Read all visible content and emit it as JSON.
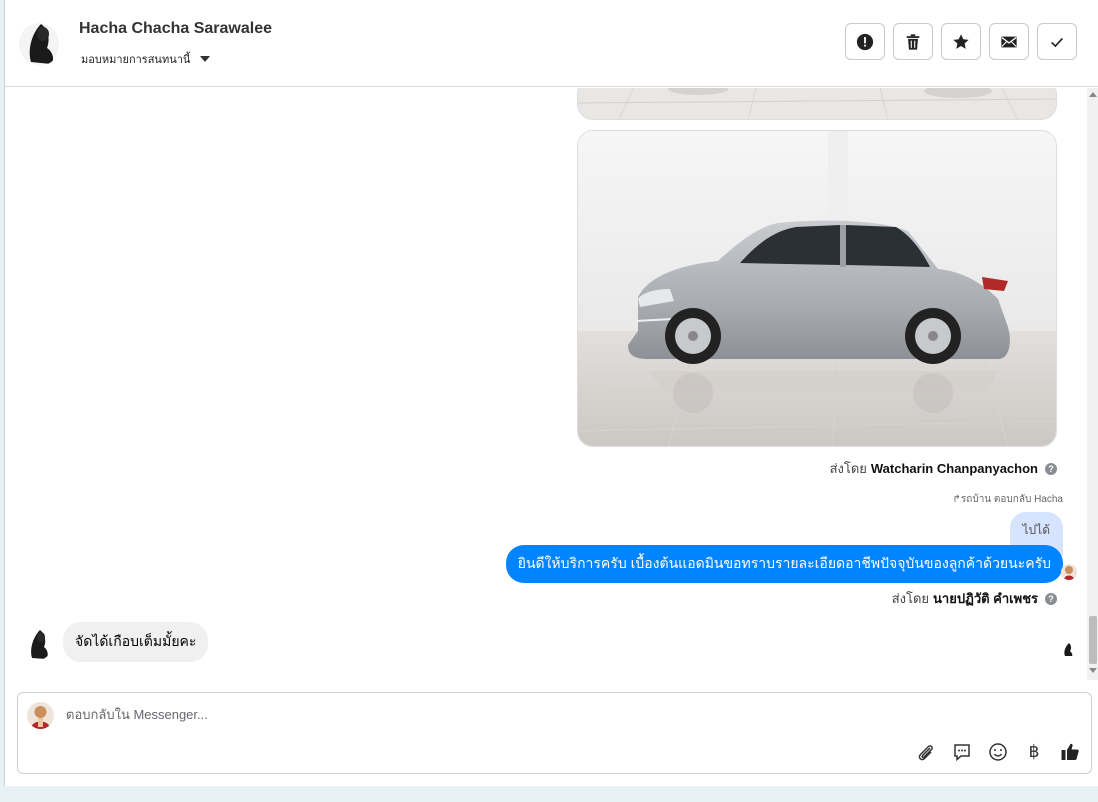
{
  "header": {
    "contact_name": "Hacha Chacha Sarawalee",
    "assign_label": "มอบหมายการสนทนานี้",
    "actions": [
      {
        "name": "report-icon",
        "label": "report"
      },
      {
        "name": "trash-icon",
        "label": "delete"
      },
      {
        "name": "star-icon",
        "label": "star"
      },
      {
        "name": "envelope-icon",
        "label": "mark unread"
      },
      {
        "name": "check-icon",
        "label": "done"
      }
    ]
  },
  "messages": {
    "image_sender_prefix": "ส่งโดย",
    "image_sender_name": "Watcharin Chanpanyachon",
    "reply_note": "รถบ้าน ตอบกลับ Hacha",
    "quoted_text": "ไปได้",
    "outgoing_text": "ยินดีให้บริการครับ เบื้องต้นแอดมินขอทราบรายละเอียดอาชีพปัจจุบันของลูกค้าด้วยนะครับ",
    "outgoing_sender_prefix": "ส่งโดย",
    "outgoing_sender_name": "นายปฏิวัติ คำเพชร",
    "incoming_text": "จัดได้เกือบเต็มมั้ยคะ"
  },
  "composer": {
    "placeholder": "ตอบกลับใน Messenger...",
    "value": "",
    "baht_symbol": "฿"
  },
  "colors": {
    "accent": "#0084ff",
    "quoted_bg": "#d6e4ff",
    "incoming_bg": "#f0f0f0"
  }
}
